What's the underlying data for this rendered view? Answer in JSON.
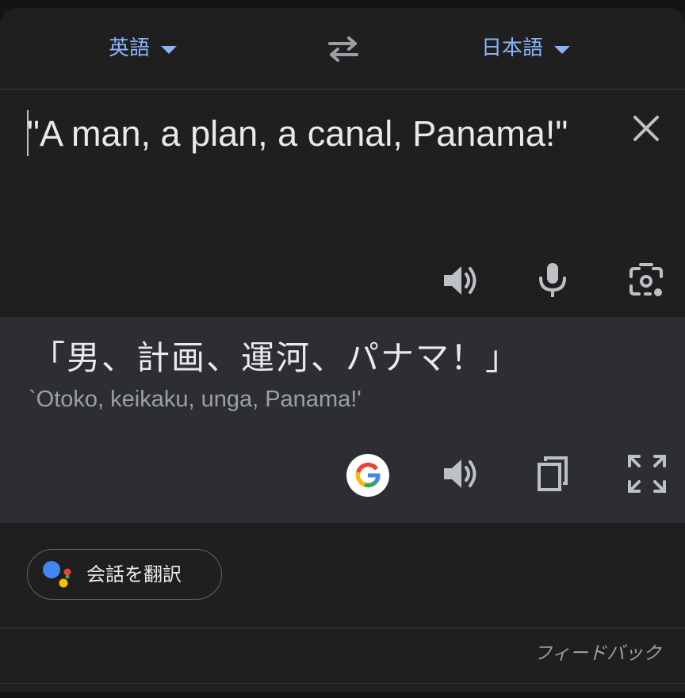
{
  "languages": {
    "source": "英語",
    "target": "日本語"
  },
  "source": {
    "text": "\"A man, a plan, a canal, Panama!\""
  },
  "result": {
    "translation": "「男、計画、運河、パナマ！」",
    "romanization": "`Otoko, keikaku, unga, Panama!'"
  },
  "actions": {
    "conversation_label": "会話を翻訳",
    "feedback_label": "フィードバック"
  },
  "icons": {
    "swap": "swap-arrows-icon",
    "clear": "close-icon",
    "source_speaker": "speaker-icon",
    "mic": "microphone-icon",
    "camera": "camera-icon",
    "google": "google-logo-icon",
    "result_speaker": "speaker-icon",
    "copy": "copy-icon",
    "fullscreen": "fullscreen-icon",
    "assistant": "assistant-logo-icon"
  },
  "colors": {
    "accent": "#8ab4f8",
    "background": "#1f1f1f",
    "result_background": "#2d2e31",
    "text": "#e8eaed",
    "secondary_text": "#9aa0a6"
  }
}
